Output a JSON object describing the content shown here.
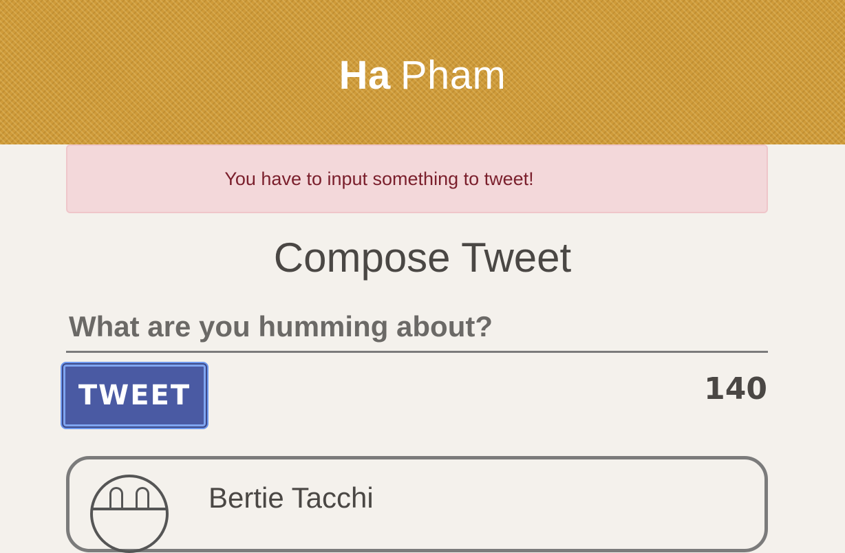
{
  "header": {
    "first_name": "Ha",
    "last_name": "Pham"
  },
  "alert": {
    "message": "You have to input something to tweet!"
  },
  "compose": {
    "title": "Compose Tweet",
    "input_placeholder": "What are you humming about?",
    "input_value": "",
    "button_label": "TWEET",
    "char_count": "140"
  },
  "tweets": [
    {
      "author_name": "Bertie Tacchi",
      "avatar_icon": "avatar-icon"
    }
  ],
  "colors": {
    "header_bg": "#cf9b3a",
    "alert_bg": "#f3d8da",
    "alert_text": "#7a1f2c",
    "button_bg": "#4a5aa3",
    "page_bg": "#f4f1ec"
  }
}
